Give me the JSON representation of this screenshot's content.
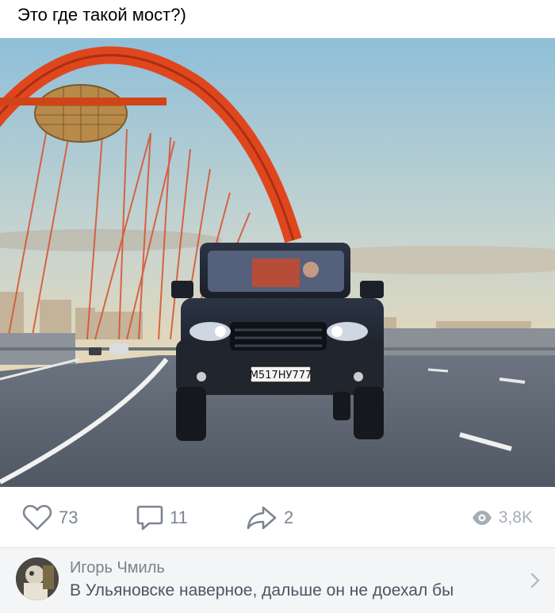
{
  "post": {
    "text": "Это где такой мост?)"
  },
  "photo": {
    "license_plate": "М517НУ777",
    "description_icon": "photo-bridge-car"
  },
  "actions": {
    "likes": "73",
    "comments": "11",
    "shares": "2",
    "views": "3,8K"
  },
  "comment": {
    "author": "Игорь Чмиль",
    "text": "В Ульяновске наверное, дальше он не доехал бы"
  },
  "colors": {
    "bridge": "#e0461e",
    "icon": "#7c8591",
    "views": "#a6adb6",
    "comment_bg": "#f4f5f7"
  }
}
